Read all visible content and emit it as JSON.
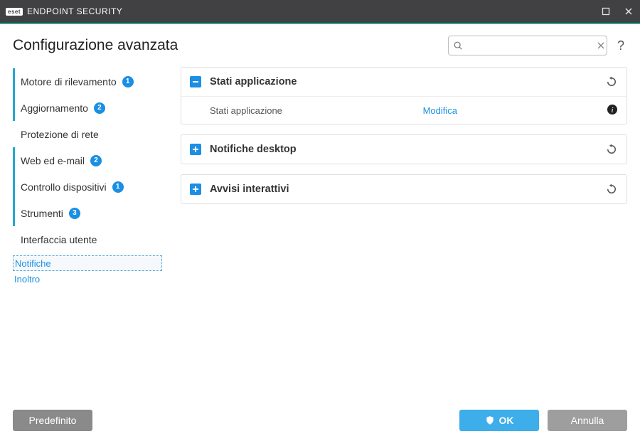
{
  "window": {
    "title_brand": "eset",
    "title_product": "ENDPOINT SECURITY"
  },
  "page": {
    "title": "Configurazione avanzata",
    "search_placeholder": ""
  },
  "sidebar": {
    "items": [
      {
        "label": "Motore di rilevamento",
        "badge": "1",
        "marked": true
      },
      {
        "label": "Aggiornamento",
        "badge": "2",
        "marked": true
      },
      {
        "label": "Protezione di rete",
        "badge": null,
        "marked": false
      },
      {
        "label": "Web ed e-mail",
        "badge": "2",
        "marked": true
      },
      {
        "label": "Controllo dispositivi",
        "badge": "1",
        "marked": true
      },
      {
        "label": "Strumenti",
        "badge": "3",
        "marked": true
      },
      {
        "label": "Interfaccia utente",
        "badge": null,
        "marked": false
      }
    ],
    "subitems": [
      {
        "label": "Notifiche",
        "active": true
      },
      {
        "label": "Inoltro",
        "active": false
      }
    ]
  },
  "panels": [
    {
      "title": "Stati applicazione",
      "expanded": true,
      "rows": [
        {
          "label": "Stati applicazione",
          "action": "Modifica",
          "info": true
        }
      ]
    },
    {
      "title": "Notifiche desktop",
      "expanded": false
    },
    {
      "title": "Avvisi interattivi",
      "expanded": false
    }
  ],
  "footer": {
    "default": "Predefinito",
    "ok": "OK",
    "cancel": "Annulla"
  }
}
